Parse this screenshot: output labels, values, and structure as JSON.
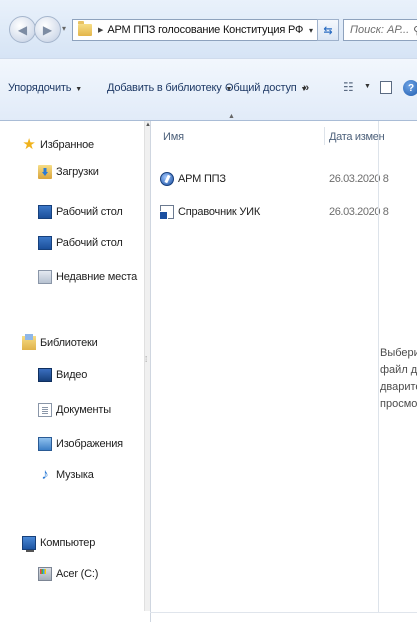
{
  "address_bar": {
    "breadcrumb": "АРМ ППЗ голосование Конституция РФ",
    "search_placeholder": "Поиск: АР..."
  },
  "toolbar": {
    "organize": "Упорядочить",
    "add_to_library": "Добавить в библиотеку",
    "share": "Общий доступ",
    "more": "»"
  },
  "nav": {
    "favorites": {
      "label": "Избранное",
      "items": [
        "Загрузки",
        "Рабочий стол",
        "Рабочий стол",
        "Недавние места"
      ]
    },
    "libraries": {
      "label": "Библиотеки",
      "items": [
        "Видео",
        "Документы",
        "Изображения",
        "Музыка"
      ]
    },
    "computer": {
      "label": "Компьютер",
      "items": [
        "Acer (C:)"
      ]
    }
  },
  "file_list": {
    "columns": {
      "name": "Имя",
      "date": "Дата измен"
    },
    "files": [
      {
        "name": "АРМ ППЗ",
        "date": "26.03.2020 8"
      },
      {
        "name": "Справочник УИК",
        "date": "26.03.2020 8"
      }
    ]
  },
  "preview": {
    "lines": [
      "Выберит",
      "файл для",
      "дварительн",
      "просмотр"
    ]
  },
  "icons": {
    "favorites": "star-icon",
    "downloads": "downloads-folder-icon",
    "desktop": "desktop-icon",
    "recent": "recent-places-icon",
    "libraries": "libraries-icon",
    "video": "video-library-icon",
    "documents": "documents-library-icon",
    "images": "pictures-library-icon",
    "music": "music-note-icon",
    "computer": "computer-icon",
    "drive": "drive-icon"
  }
}
